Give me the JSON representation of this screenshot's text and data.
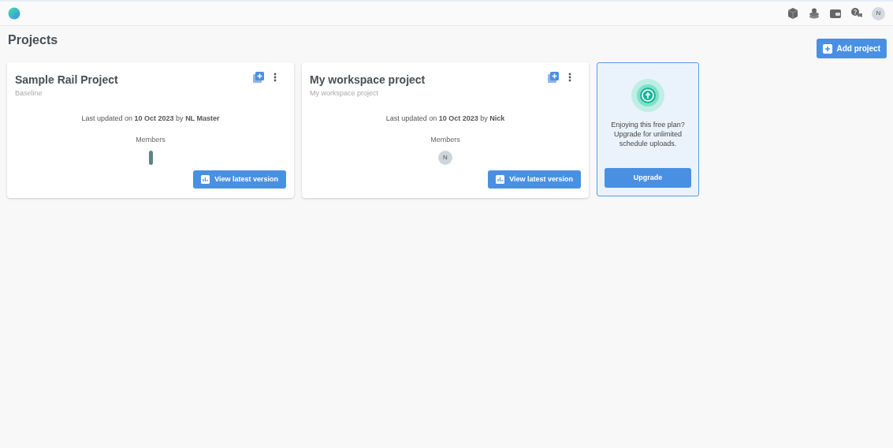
{
  "header": {
    "user_initial": "N"
  },
  "page_title": "Projects",
  "add_button": "Add project",
  "projects": [
    {
      "title": "Sample Rail Project",
      "subtitle": "Baseline",
      "updated": "Last updated on **10 Oct 2023** by **NL Master**",
      "members_label": "Members",
      "members": [
        {
          "kind": "bar"
        }
      ],
      "button": "View latest version"
    },
    {
      "title": "My workspace project",
      "subtitle": "My workspace project",
      "updated": "Last updated on **10 Oct 2023** by **Nick**",
      "members_label": "Members",
      "members": [
        {
          "kind": "avatar",
          "initial": "N"
        }
      ],
      "button": "View latest version"
    }
  ],
  "upgrade": {
    "text": "Enjoying this free plan? Upgrade for unlimited schedule uploads.",
    "button": "Upgrade"
  }
}
